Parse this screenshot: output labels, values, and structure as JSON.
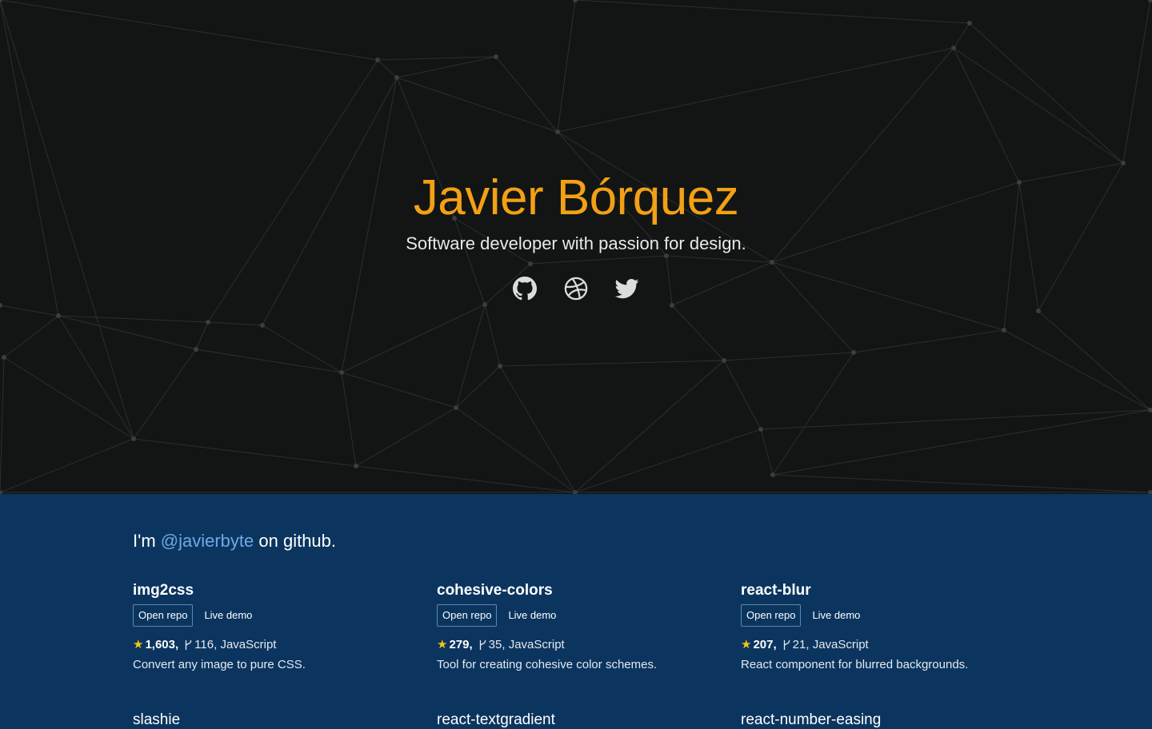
{
  "hero": {
    "title": "Javier Bórquez",
    "subtitle": "Software developer with passion for design.",
    "background_color": "#121514",
    "title_color": "#f2a015",
    "social": [
      {
        "name": "github-icon"
      },
      {
        "name": "dribbble-icon"
      },
      {
        "name": "twitter-icon"
      }
    ]
  },
  "intro": {
    "prefix": "I'm ",
    "handle": "@javierbyte",
    "suffix": " on github."
  },
  "repos": [
    {
      "name": "img2css",
      "open_label": "Open repo",
      "demo_label": "Live demo",
      "stars": "1,603,",
      "forks": "116,",
      "language": "JavaScript",
      "description": "Convert any image to pure CSS."
    },
    {
      "name": "cohesive-colors",
      "open_label": "Open repo",
      "demo_label": "Live demo",
      "stars": "279,",
      "forks": "35,",
      "language": "JavaScript",
      "description": "Tool for creating cohesive color schemes."
    },
    {
      "name": "react-blur",
      "open_label": "Open repo",
      "demo_label": "Live demo",
      "stars": "207,",
      "forks": "21,",
      "language": "JavaScript",
      "description": "React component for blurred backgrounds."
    }
  ],
  "next_repos": [
    "slashie",
    "react-textgradient",
    "react-number-easing"
  ],
  "colors": {
    "section_background": "#0b355f",
    "link": "#6fa8e8",
    "star": "#f5c518"
  }
}
